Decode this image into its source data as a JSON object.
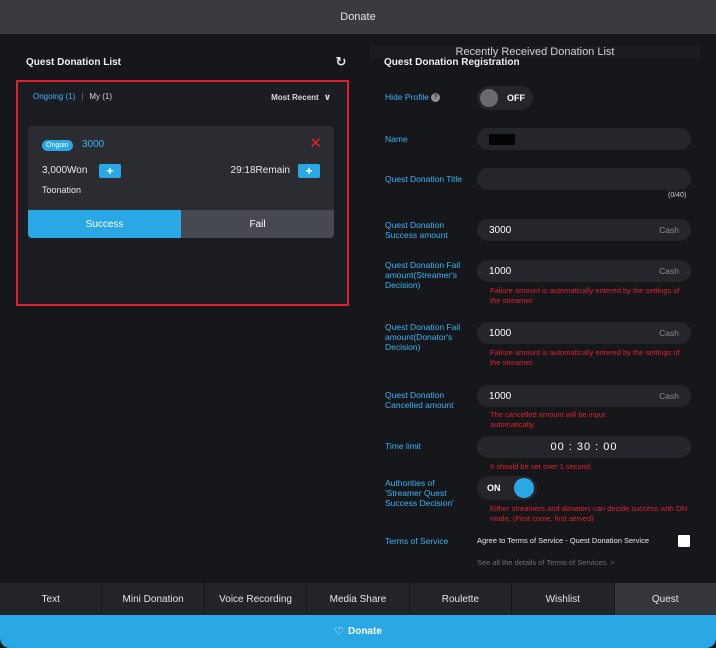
{
  "top_tabs": [
    "Donate",
    "Recently Received Donation List"
  ],
  "left": {
    "title": "Quest Donation List",
    "refresh_icon": "refresh-icon",
    "filter_ongoing": "Ongoing (1)",
    "filter_sep": "|",
    "filter_my": "My (1)",
    "sort": "Most Recent",
    "card": {
      "badge": "Ongoin",
      "title": "3000",
      "amount": "3,000Won",
      "remain": "29:18Remain",
      "platform": "Toonation",
      "success": "Success",
      "fail": "Fail"
    }
  },
  "right": {
    "title": "Quest Donation Registration",
    "hide_profile_label": "Hide Profile",
    "hide_profile_state": "OFF",
    "name_label": "Name",
    "title_label": "Quest Donation Title",
    "title_counter": "(0/40)",
    "success_label": "Quest Donation Success amount",
    "success_value": "3000",
    "unit": "Cash",
    "fail_streamer_label": "Quest Donation Fail amount(Streamer's Decision)",
    "fail_streamer_value": "1000",
    "fail_donator_label": "Quest Donation Fail amount(Donator's Decision)",
    "fail_donator_value": "1000",
    "fail_note": "Failure amount is automatically entered by the settings of the streamer.",
    "cancelled_label": "Quest Donation Cancelled amount",
    "cancelled_value": "1000",
    "cancelled_note": "The cancelled amount will be input automatically.",
    "time_label": "Time limit",
    "time_value": "00 : 30 : 00",
    "time_note": "It should be set over 1 second.",
    "auth_label": "Authorities of 'Streamer Quest Success Decision'",
    "auth_state": "ON",
    "auth_note": "Either streamers and donators can decide success with ON mode. (First come, first served)",
    "tos_label": "Terms of Service",
    "tos_agree": "Agree to Terms of Service - Quest Donation Service",
    "tos_link": "See all the details of Terms of Services. >"
  },
  "bottom_tabs": [
    "Text",
    "Mini Donation",
    "Voice Recording",
    "Media Share",
    "Roulette",
    "Wishlist",
    "Quest"
  ],
  "donate_button": "Donate",
  "colors": {
    "accent": "#2aa8e6",
    "error": "#e0202a",
    "bg": "#16171b"
  }
}
